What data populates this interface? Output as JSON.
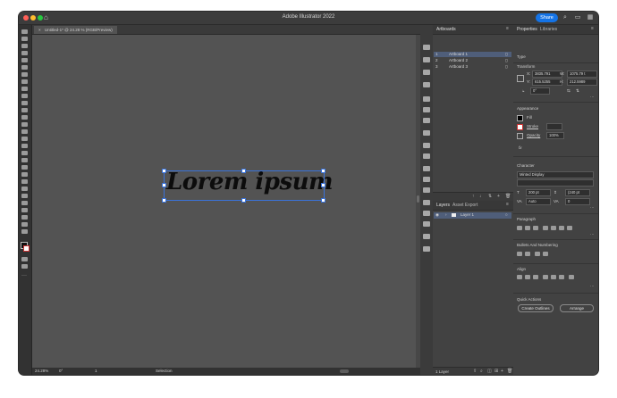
{
  "window": {
    "title": "Adobe Illustrator 2022",
    "share_label": "Share"
  },
  "document_tab": {
    "label": "Untitled-1* @ 24.28 % (RGB/Preview)"
  },
  "canvas": {
    "text": "Lorem ipsum"
  },
  "status": {
    "zoom": "24.28%",
    "rotation": "0°",
    "artboard": "1",
    "tool": "Selection"
  },
  "artboards_panel": {
    "title": "Artboards",
    "items": [
      {
        "num": "1",
        "name": "Artboard 1"
      },
      {
        "num": "2",
        "name": "Artboard 2"
      },
      {
        "num": "3",
        "name": "Artboard 3"
      }
    ]
  },
  "layers_panel": {
    "tab1": "Layers",
    "tab2": "Asset Export",
    "layer_name": "Layer 1",
    "footer": "1 Layer"
  },
  "properties_panel": {
    "tab1": "Properties",
    "tab2": "Libraries",
    "type_label": "Type",
    "transform_label": "Transform",
    "x": "3835.791",
    "w": "1075.79 t",
    "y": "615.5255",
    "h": "212.5989",
    "angle": "0°",
    "appearance_label": "Appearance",
    "fill_label": "Fill",
    "stroke_label": "Stroke",
    "opacity_label": "Opacity",
    "opacity_value": "100%",
    "fx_label": "fx",
    "character_label": "Character",
    "font_name": "Minted Display",
    "font_size": "200 pt",
    "leading": "(240 pt",
    "tracking": "Auto",
    "kerning": "0",
    "paragraph_label": "Paragraph",
    "bullets_label": "Bullets And Numbering",
    "align_label": "Align",
    "quick_actions_label": "Quick Actions",
    "create_outlines": "Create Outlines",
    "arrange": "Arrange"
  }
}
